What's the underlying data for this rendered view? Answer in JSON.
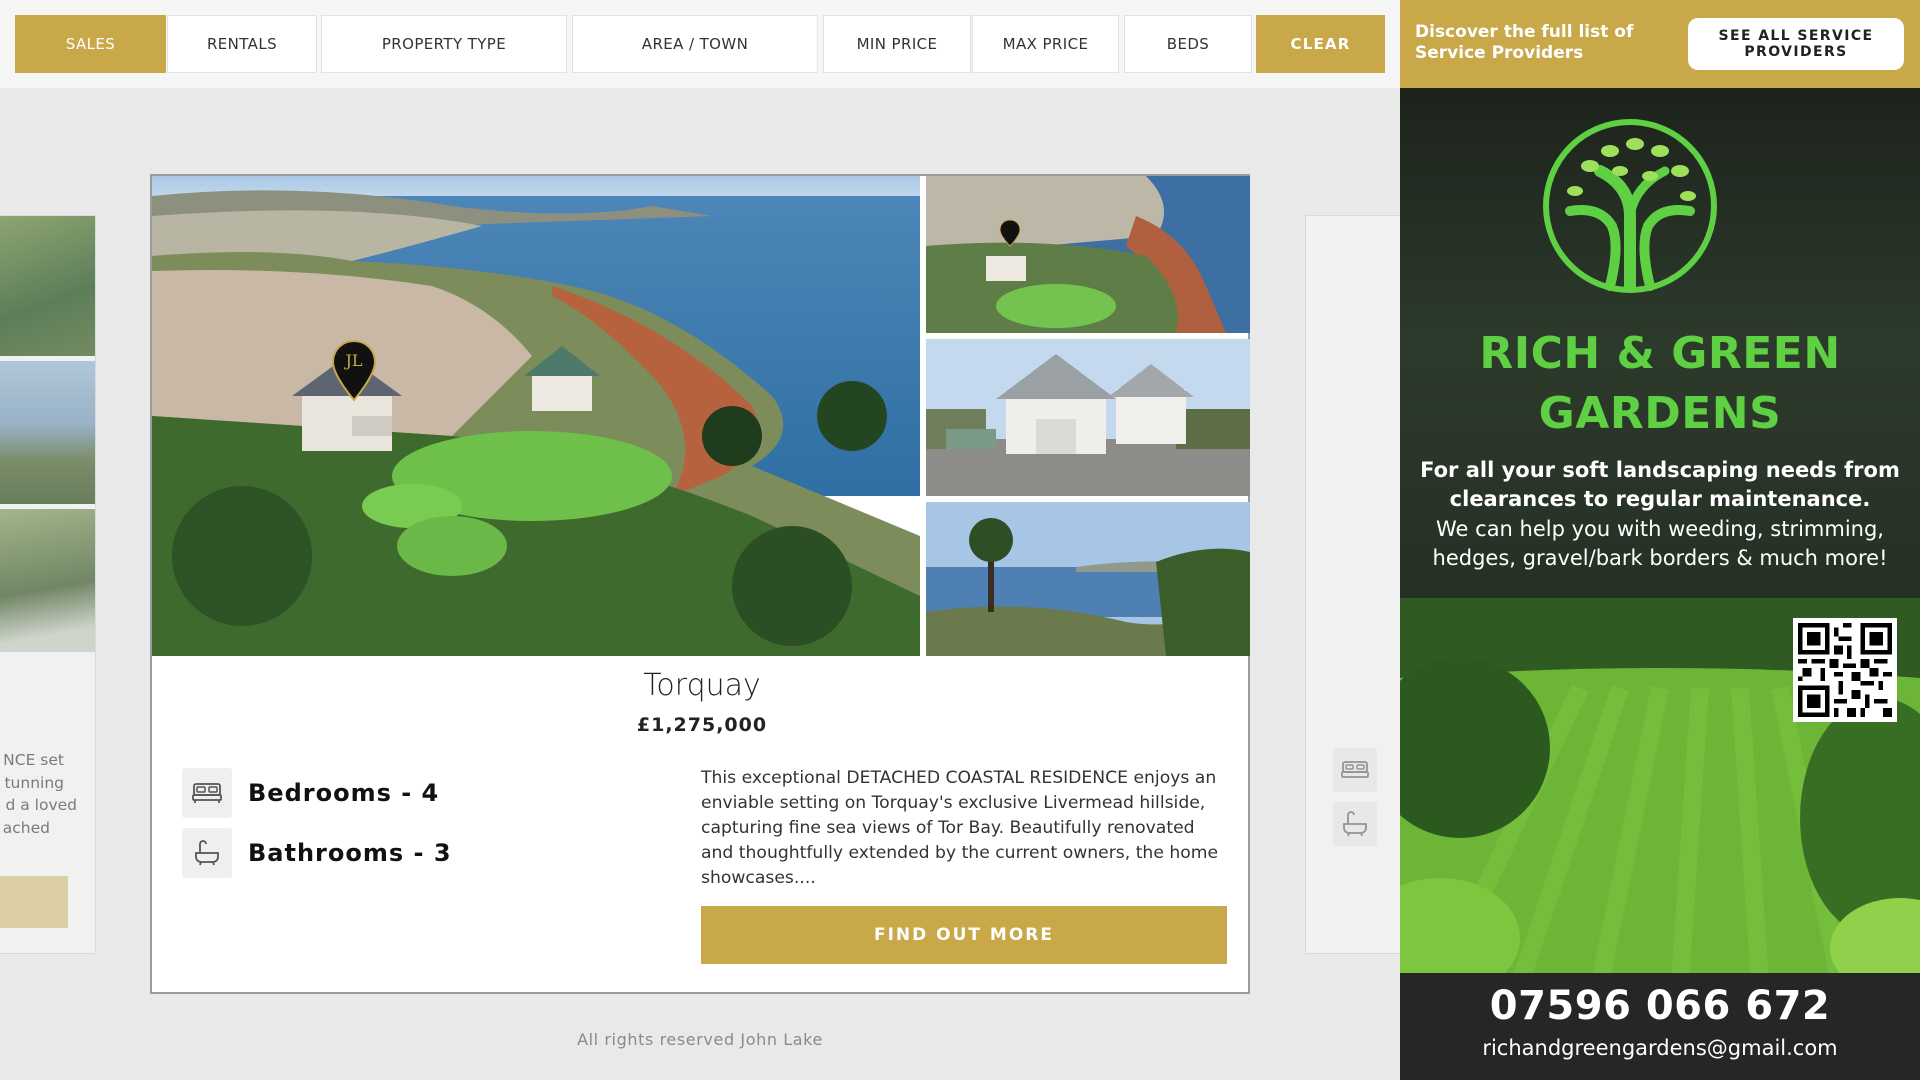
{
  "filters": {
    "sales": "SALES",
    "rentals": "RENTALS",
    "property_type": "PROPERTY TYPE",
    "area_town": "AREA / TOWN",
    "min_price": "MIN PRICE",
    "max_price": "MAX PRICE",
    "beds": "BEDS",
    "clear": "CLEAR"
  },
  "left_peek": {
    "text_lines": [
      "NCE set",
      "tunning",
      "d a loved",
      "ached"
    ]
  },
  "listing": {
    "town": "Torquay",
    "price": "£1,275,000",
    "bedrooms": "Bedrooms - 4",
    "bathrooms": "Bathrooms - 3",
    "description": "This exceptional DETACHED COASTAL RESIDENCE enjoys an enviable setting on Torquay's exclusive Livermead hillside, capturing fine sea views of Tor Bay. Beautifully renovated and thoughtfully extended by the current owners, the home showcases....",
    "cta": "FIND OUT MORE",
    "pin_monogram": "JL"
  },
  "footer": {
    "text": "All rights reserved John Lake"
  },
  "sidebar": {
    "discover": "Discover the full list of Service Providers",
    "see_all": "SEE ALL SERVICE PROVIDERS"
  },
  "ad": {
    "title": "RICH & GREEN GARDENS",
    "line_bold": "For all your soft landscaping needs from clearances to regular maintenance.",
    "line_regular": "We can help you with weeding, strimming, hedges, gravel/bark borders & much more!",
    "phone": "07596 066 672",
    "email": "richandgreengardens@gmail.com"
  },
  "colors": {
    "accent_gold": "#c9a84a",
    "ad_green": "#5fd043"
  },
  "icons": {
    "bed": "bed-icon",
    "bath": "bath-icon",
    "location_pin": "map-pin-icon",
    "tree_logo": "tree-logo-icon",
    "qr": "qr-code-icon"
  }
}
